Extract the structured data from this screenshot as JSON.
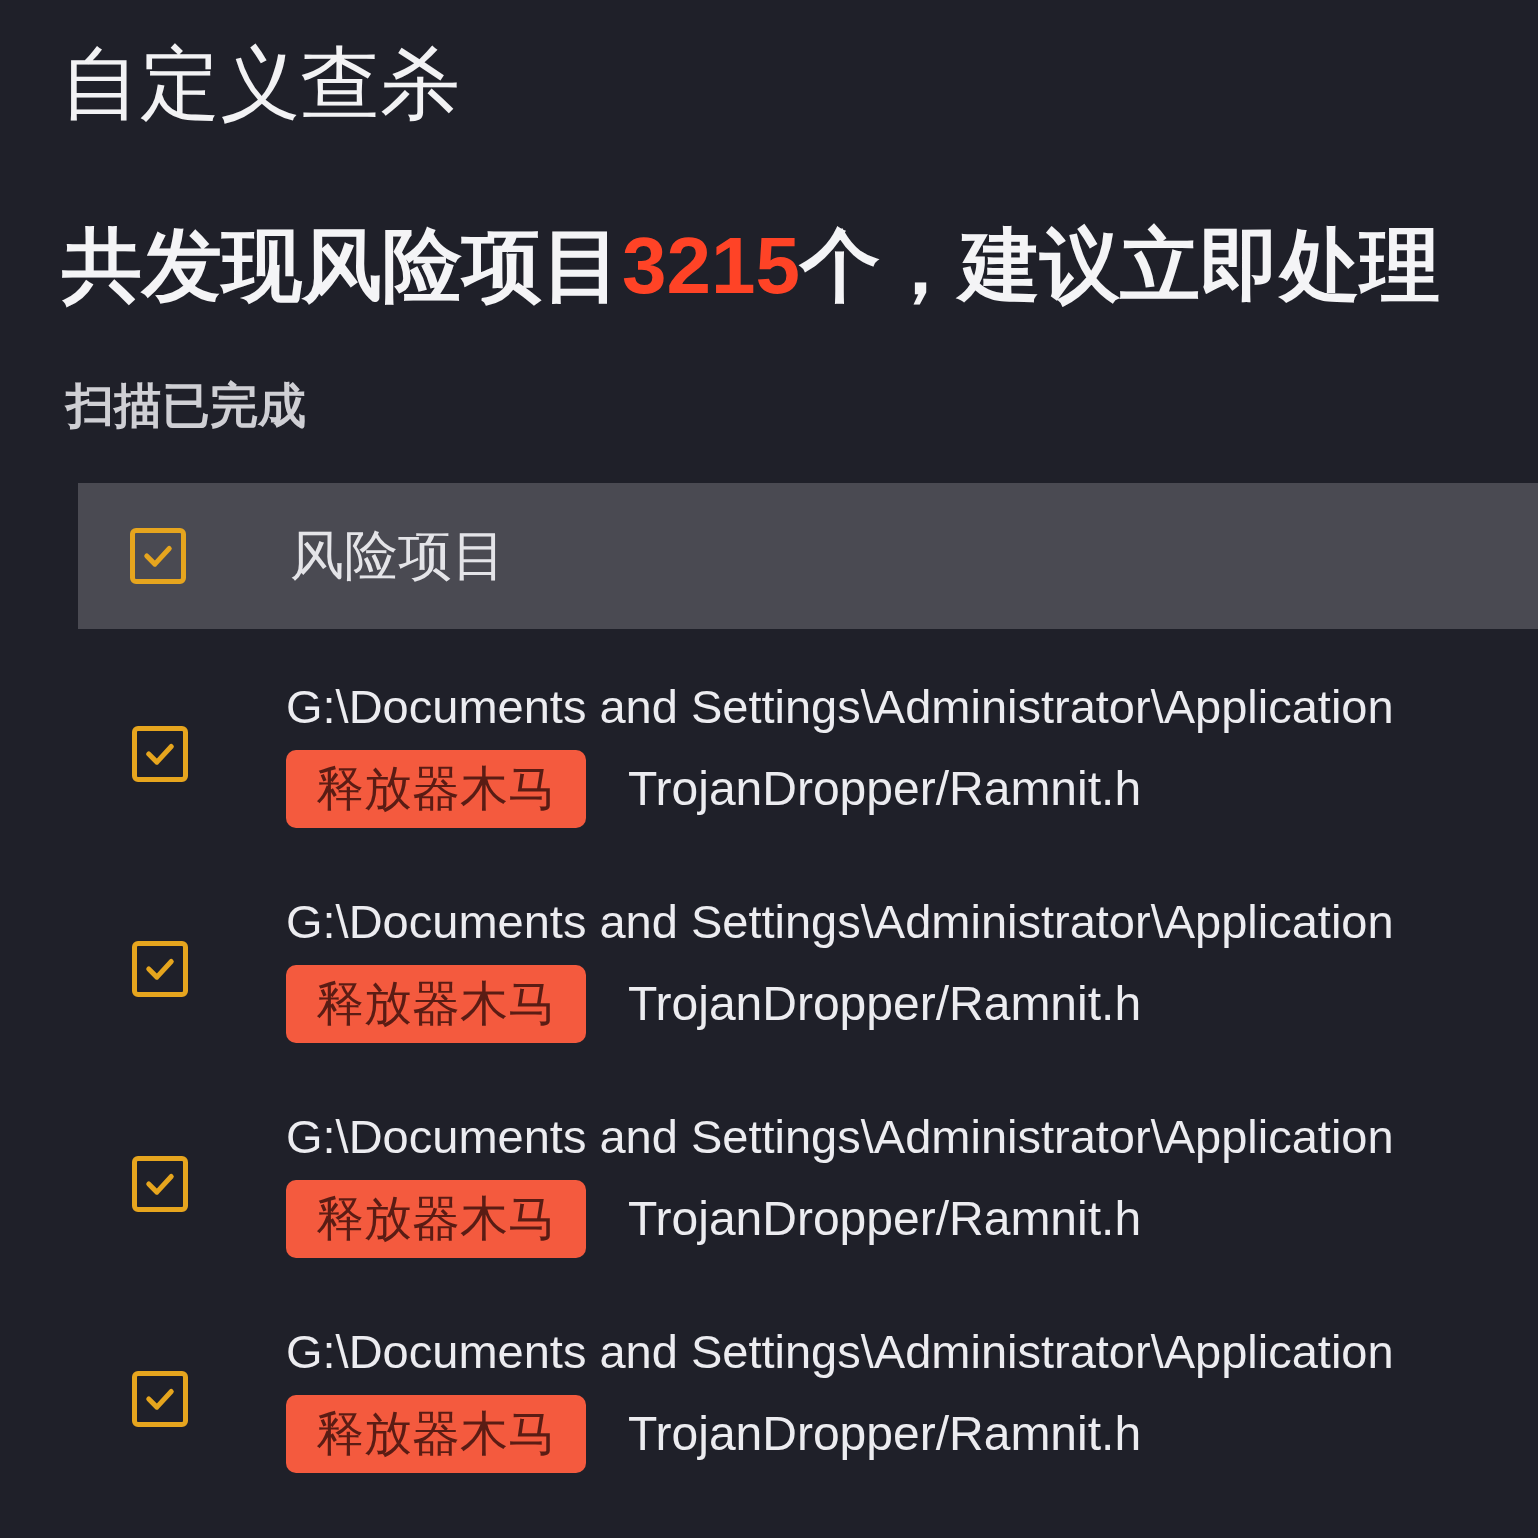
{
  "title": "自定义查杀",
  "summary": {
    "prefix": "共发现风险项目",
    "count": "3215",
    "suffix": "个，建议立即处理"
  },
  "status": "扫描已完成",
  "table": {
    "header": {
      "checked": true,
      "label": "风险项目"
    },
    "rows": [
      {
        "checked": true,
        "path": "G:\\Documents and Settings\\Administrator\\Application",
        "tag": "释放器木马",
        "threat": "TrojanDropper/Ramnit.h"
      },
      {
        "checked": true,
        "path": "G:\\Documents and Settings\\Administrator\\Application",
        "tag": "释放器木马",
        "threat": "TrojanDropper/Ramnit.h"
      },
      {
        "checked": true,
        "path": "G:\\Documents and Settings\\Administrator\\Application",
        "tag": "释放器木马",
        "threat": "TrojanDropper/Ramnit.h"
      },
      {
        "checked": true,
        "path": "G:\\Documents and Settings\\Administrator\\Application",
        "tag": "释放器木马",
        "threat": "TrojanDropper/Ramnit.h"
      }
    ]
  }
}
